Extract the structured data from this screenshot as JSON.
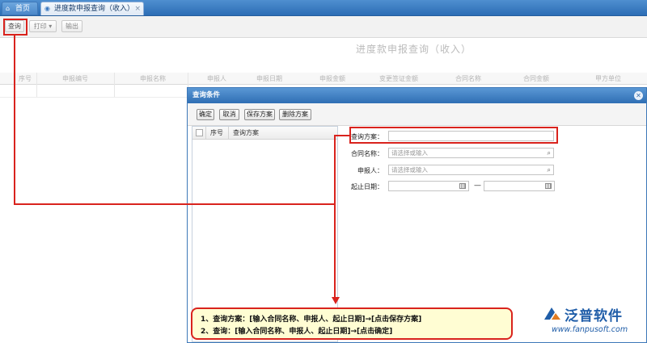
{
  "tabs": [
    {
      "label": "首页",
      "icon": "home-icon"
    },
    {
      "label": "进度款申报查询（收入）",
      "icon": "page-icon",
      "close": "×"
    }
  ],
  "toolbar": {
    "query": "查询",
    "print": "打印",
    "print_arrow": "▾",
    "export": "输出"
  },
  "page_title": "进度款申报查询（收入）",
  "grid": {
    "columns": [
      "序号",
      "申报编号",
      "申报名称",
      "申报人",
      "申报日期",
      "申报金额",
      "变更签证金额",
      "合同名称",
      "合同金额",
      "甲方单位"
    ]
  },
  "dialog": {
    "title": "查询条件",
    "close": "✕",
    "buttons": {
      "confirm": "确定",
      "cancel": "取消",
      "save_plan": "保存方案",
      "delete_plan": "删除方案"
    },
    "list_columns": [
      "序号",
      "查询方案"
    ],
    "form": {
      "plan_label": "查询方案：",
      "plan_value": "",
      "contract_label": "合同名称：",
      "contract_placeholder": "请选择或输入",
      "reporter_label": "申报人：",
      "reporter_placeholder": "请选择或输入",
      "date_label": "起止日期：",
      "date_sep": "—"
    }
  },
  "callout": {
    "line1": "1、查询方案：[输入合同名称、申报人、起止日期]→[点击保存方案]",
    "line2": "2、查询：[输入合同名称、申报人、起止日期]→[点击确定]"
  },
  "logo": {
    "name": "泛普软件",
    "url": "www.fanpusoft.com"
  },
  "colors": {
    "annotation": "#d9231d",
    "header": "#2f6fb4",
    "callout_bg": "#fffdd3"
  }
}
